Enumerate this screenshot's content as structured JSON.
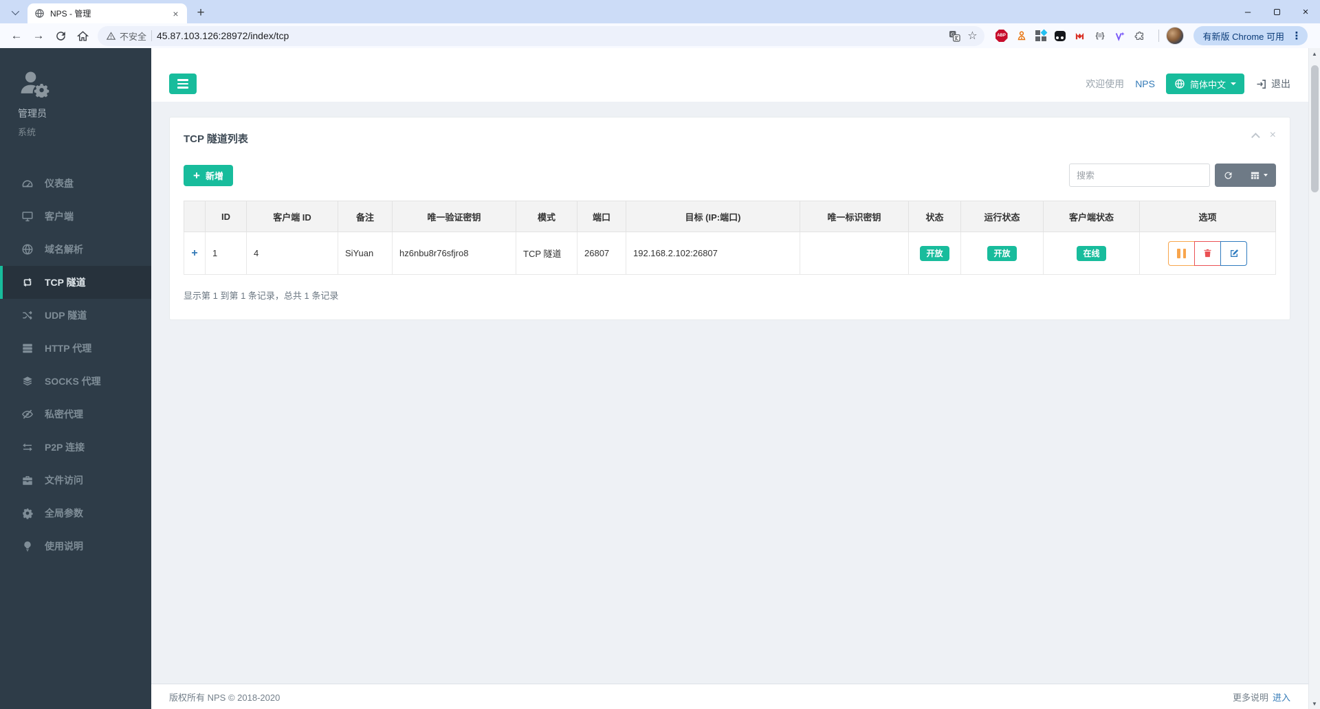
{
  "browser": {
    "tab_title": "NPS - 管理",
    "new_tab_label": "+",
    "security_label": "不安全",
    "url": "45.87.103.126:28972/index/tcp",
    "abp_label": "ABP",
    "braces_label": "{≡}",
    "update_label": "有新版 Chrome 可用"
  },
  "sidebar": {
    "user_name": "管理员",
    "user_role": "系统",
    "items": [
      {
        "label": "仪表盘",
        "icon": "gauge-icon"
      },
      {
        "label": "客户端",
        "icon": "desktop-icon"
      },
      {
        "label": "域名解析",
        "icon": "globe-icon"
      },
      {
        "label": "TCP 隧道",
        "icon": "repeat-icon",
        "active": true
      },
      {
        "label": "UDP 隧道",
        "icon": "shuffle-icon"
      },
      {
        "label": "HTTP 代理",
        "icon": "server-icon"
      },
      {
        "label": "SOCKS 代理",
        "icon": "layers-icon"
      },
      {
        "label": "私密代理",
        "icon": "eye-slash-icon"
      },
      {
        "label": "P2P 连接",
        "icon": "exchange-icon"
      },
      {
        "label": "文件访问",
        "icon": "briefcase-icon"
      },
      {
        "label": "全局参数",
        "icon": "gear-icon"
      },
      {
        "label": "使用说明",
        "icon": "lightbulb-icon"
      }
    ]
  },
  "topbar": {
    "welcome": "欢迎使用",
    "brand": "NPS",
    "language": "简体中文",
    "logout": "退出"
  },
  "panel": {
    "title": "TCP 隧道列表",
    "add_button": "新增",
    "search_placeholder": "搜索",
    "table": {
      "columns": [
        "",
        "ID",
        "客户端 ID",
        "备注",
        "唯一验证密钥",
        "模式",
        "端口",
        "目标 (IP:端口)",
        "唯一标识密钥",
        "状态",
        "运行状态",
        "客户端状态",
        "选项"
      ],
      "rows": [
        {
          "expand": "+",
          "id": "1",
          "client_id": "4",
          "remark": "SiYuan",
          "verify_key": "hz6nbu8r76sfjro8",
          "mode": "TCP 隧道",
          "port": "26807",
          "target": "192.168.2.102:26807",
          "unique_key": "",
          "status": "开放",
          "run_status": "开放",
          "client_status": "在线"
        }
      ]
    },
    "pagination": "显示第 1 到第 1 条记录，总共 1 条记录"
  },
  "footer": {
    "copyright": "版权所有 NPS © 2018-2020",
    "more_label": "更多说明",
    "enter_link": "进入"
  },
  "colors": {
    "accent": "#18bc9c",
    "sidebar_bg": "#2e3c48",
    "sidebar_active_bg": "#27323c",
    "badge_green": "#18bc9c",
    "danger_red": "#ea5053",
    "warning_orange": "#f8a54c",
    "link_blue": "#337ab7",
    "titlebar_blue": "#ccdcf7"
  }
}
